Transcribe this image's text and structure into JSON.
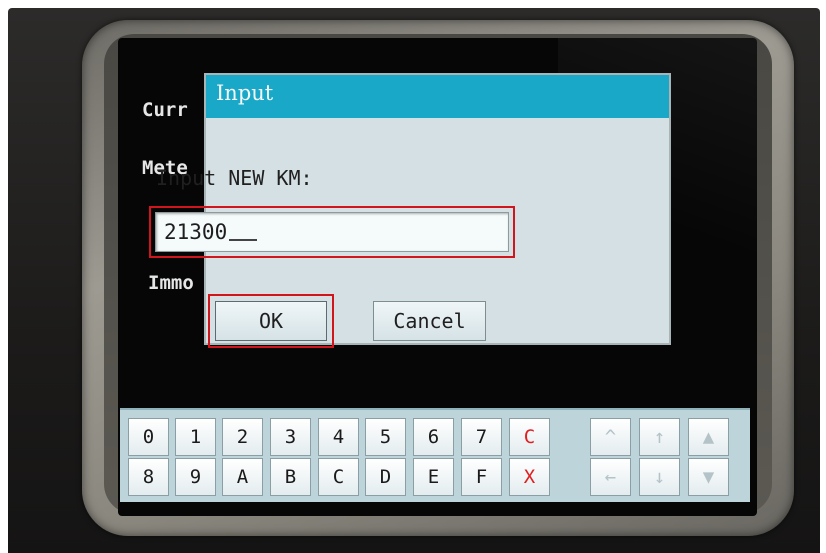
{
  "background_labels": [
    "Curr",
    "Mete",
    "Immo"
  ],
  "dialog": {
    "title": "Input",
    "prompt": "Input NEW KM:",
    "input_value": "21300",
    "ok_label": "OK",
    "cancel_label": "Cancel"
  },
  "keypad": {
    "row1": [
      "0",
      "1",
      "2",
      "3",
      "4",
      "5",
      "6",
      "7",
      "C"
    ],
    "row2": [
      "8",
      "9",
      "A",
      "B",
      "C",
      "D",
      "E",
      "F",
      "X"
    ],
    "nav_row1": [
      "^",
      "↑",
      "▲"
    ],
    "nav_row2": [
      "←",
      "↓",
      "▼"
    ]
  },
  "colors": {
    "titlebar": "#1aa8c8",
    "highlight": "#d0151c",
    "dialog_bg": "#d4e0e4",
    "keypad_bg": "#bcd4da"
  }
}
